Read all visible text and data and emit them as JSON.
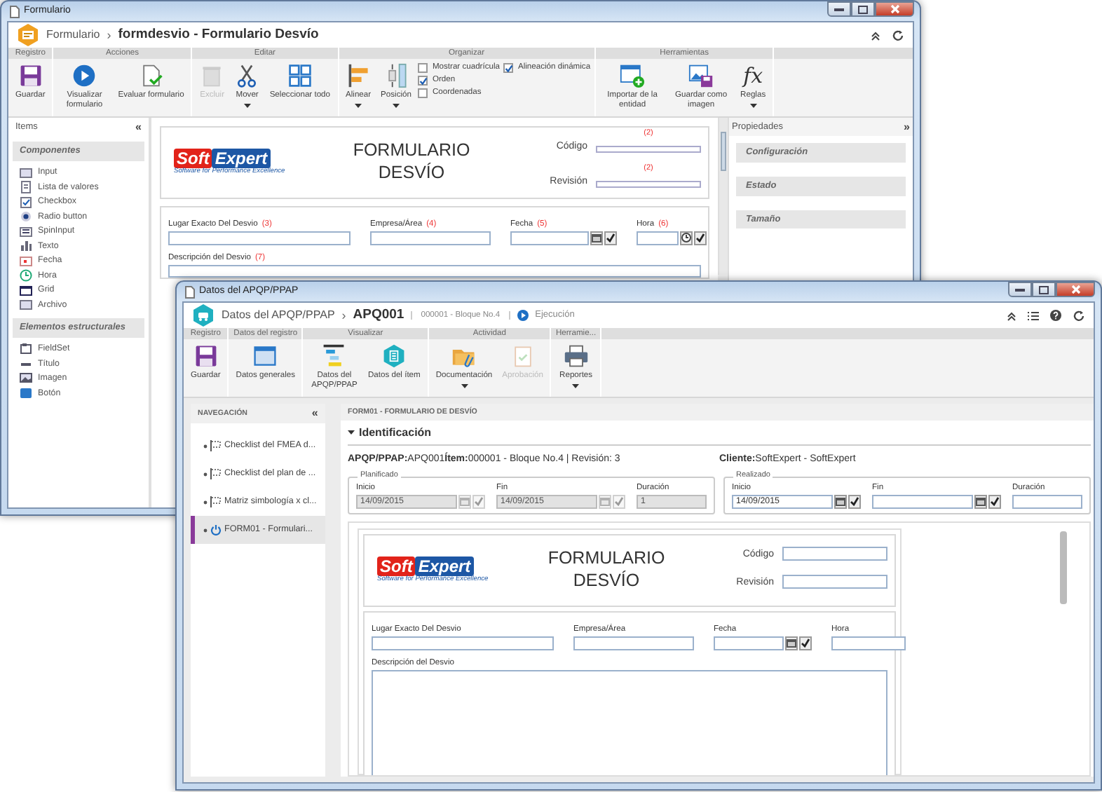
{
  "back_window": {
    "title": "Formulario",
    "module": "Formulario",
    "separator": "›",
    "record": "formdesvio - Formulario Desvío",
    "ribbon": [
      {
        "label": "Registro",
        "items": [
          {
            "kind": "button",
            "label": "Guardar",
            "disabled": false,
            "menu": false
          }
        ]
      },
      {
        "label": "Acciones",
        "items": [
          {
            "kind": "button",
            "label": "Visualizar formulario",
            "disabled": false,
            "menu": false
          },
          {
            "kind": "button",
            "label": "Evaluar formulario",
            "disabled": false,
            "menu": false
          }
        ]
      },
      {
        "label": "Editar",
        "items": [
          {
            "kind": "button",
            "label": "Excluir",
            "disabled": true,
            "menu": false
          },
          {
            "kind": "button",
            "label": "Mover",
            "disabled": false,
            "menu": true
          },
          {
            "kind": "button",
            "label": "Seleccionar todo",
            "disabled": false,
            "menu": false
          }
        ]
      },
      {
        "label": "Organizar",
        "items": [
          {
            "kind": "button",
            "label": "Alinear",
            "disabled": false,
            "menu": true
          },
          {
            "kind": "button",
            "label": "Posición",
            "disabled": false,
            "menu": true
          },
          {
            "kind": "checkbox",
            "label": "Mostrar cuadrícula",
            "checked": false
          },
          {
            "kind": "checkbox",
            "label": "Orden",
            "checked": true
          },
          {
            "kind": "checkbox",
            "label": "Coordenadas",
            "checked": false
          },
          {
            "kind": "checkbox",
            "label": "Alineación dinámica",
            "checked": true
          }
        ]
      },
      {
        "label": "Herramientas",
        "items": [
          {
            "kind": "button",
            "label": "Importar de la entidad",
            "disabled": false,
            "menu": false
          },
          {
            "kind": "button",
            "label": "Guardar como imagen",
            "disabled": false,
            "menu": false
          },
          {
            "kind": "button",
            "label": "Reglas",
            "glyph": "fx",
            "disabled": false,
            "menu": true
          }
        ]
      }
    ],
    "items_panel": {
      "title": "Items",
      "collapse": "«",
      "sections": [
        {
          "title": "Componentes",
          "items": [
            "Input",
            "Lista de valores",
            "Checkbox",
            "Radio button",
            "SpinInput",
            "Texto",
            "Fecha",
            "Hora",
            "Grid",
            "Archivo"
          ]
        },
        {
          "title": "Elementos estructurales",
          "items": [
            "FieldSet",
            "Título",
            "Imagen",
            "Botón"
          ]
        }
      ]
    },
    "form": {
      "logo": {
        "first": "Soft",
        "second": "Expert",
        "tagline": "Software for Performance Excellence"
      },
      "title": "FORMULARIO DESVÍO",
      "header_fields": [
        {
          "label": "Código",
          "number": "(2)"
        },
        {
          "label": "Revisión",
          "number": "(2)"
        }
      ],
      "fields": [
        {
          "label": "Lugar Exacto Del Desvio",
          "number": "(3)",
          "kind": "text"
        },
        {
          "label": "Empresa/Área",
          "number": "(4)",
          "kind": "text"
        },
        {
          "label": "Fecha",
          "number": "(5)",
          "kind": "date"
        },
        {
          "label": "Hora",
          "number": "(6)",
          "kind": "time"
        }
      ],
      "memo": {
        "label": "Descripción del Desvio",
        "number": "(7)"
      }
    },
    "properties": {
      "title": "Propiedades",
      "collapse": "»",
      "sections": [
        "Configuración",
        "Estado",
        "Tamaño"
      ]
    }
  },
  "front_window": {
    "title": "Datos del APQP/PPAP",
    "module": "Datos del APQP/PPAP",
    "separator": "›",
    "record": "APQ001",
    "item": "000001 - Bloque No.4",
    "status": "Ejecución",
    "ribbon": [
      {
        "label": "Registro",
        "items": [
          {
            "kind": "button",
            "label": "Guardar",
            "disabled": false,
            "menu": false
          }
        ]
      },
      {
        "label": "Datos del registro",
        "items": [
          {
            "kind": "button",
            "label": "Datos generales",
            "disabled": false,
            "menu": false
          }
        ]
      },
      {
        "label": "Visualizar",
        "items": [
          {
            "kind": "button",
            "label": "Datos del APQP/PPAP",
            "disabled": false,
            "menu": false
          },
          {
            "kind": "button",
            "label": "Datos del ítem",
            "disabled": false,
            "menu": false
          }
        ]
      },
      {
        "label": "Actividad",
        "items": [
          {
            "kind": "button",
            "label": "Documentación",
            "disabled": false,
            "menu": true
          },
          {
            "kind": "button",
            "label": "Aprobación",
            "disabled": true,
            "menu": false
          }
        ]
      },
      {
        "label": "Herramie...",
        "items": [
          {
            "kind": "button",
            "label": "Reportes",
            "disabled": false,
            "menu": true
          }
        ]
      }
    ],
    "navigation": {
      "title": "NAVEGACIÓN",
      "collapse": "«",
      "items": [
        {
          "label": "Checklist del FMEA d...",
          "kind": "checklist",
          "selected": false
        },
        {
          "label": "Checklist del plan de ...",
          "kind": "checklist",
          "selected": false
        },
        {
          "label": "Matriz simbología x cl...",
          "kind": "checklist",
          "selected": false
        },
        {
          "label": "FORM01 - Formulari...",
          "kind": "form",
          "selected": true
        }
      ]
    },
    "panel_title": "FORM01 - FORMULARIO DE DESVÍO",
    "section": {
      "title": "Identificación",
      "expanded": true
    },
    "summary": "**APQP/PPAP:**APQ001**Ítem:**000001 - Bloque No.4 | Revisión: 3",
    "client": "**Cliente:**SoftExpert - SoftExpert",
    "periods": [
      {
        "title": "Planificado",
        "disabled": true,
        "fields": [
          {
            "label": "Inicio",
            "value": "14/09/2015",
            "kind": "date"
          },
          {
            "label": "Fin",
            "value": "14/09/2015",
            "kind": "date"
          },
          {
            "label": "Duración",
            "value": "1",
            "kind": "text"
          }
        ]
      },
      {
        "title": "Realizado",
        "disabled": false,
        "fields": [
          {
            "label": "Inicio",
            "value": "14/09/2015",
            "kind": "date"
          },
          {
            "label": "Fin",
            "kind": "date"
          },
          {
            "label": "Duración",
            "kind": "text"
          }
        ]
      }
    ],
    "form": {
      "logo": {
        "first": "Soft",
        "second": "Expert",
        "tagline": "Software for Performance Excellence"
      },
      "title": "FORMULARIO DESVÍO",
      "header_fields": [
        {
          "label": "Código"
        },
        {
          "label": "Revisión"
        }
      ],
      "fields": [
        {
          "label": "Lugar Exacto Del Desvio",
          "kind": "text"
        },
        {
          "label": "Empresa/Área",
          "kind": "text"
        },
        {
          "label": "Fecha",
          "kind": "date"
        },
        {
          "label": "Hora",
          "kind": "text"
        }
      ],
      "memo": {
        "label": "Descripción del Desvio"
      }
    }
  }
}
